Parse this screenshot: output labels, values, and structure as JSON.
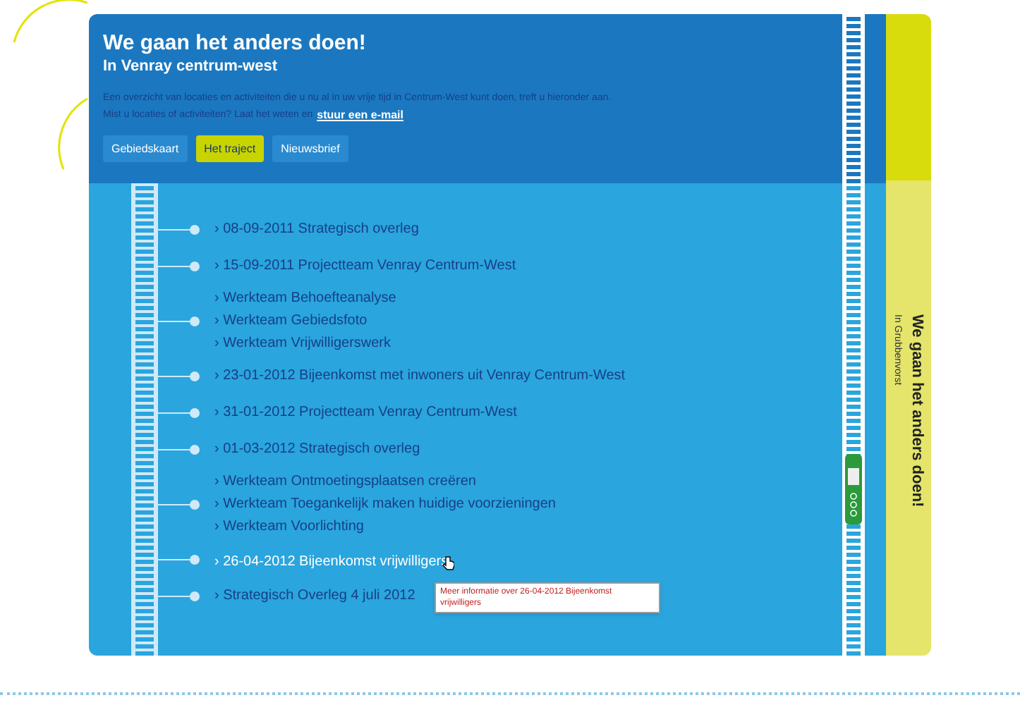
{
  "header": {
    "title": "We gaan het anders doen!",
    "subtitle": "In Venray centrum-west",
    "intro": [
      "Een overzicht van locaties en activiteiten die u nu al in uw vrije tijd in Centrum-West kunt doen, treft u hieronder aan.",
      "Mist u locaties of activiteiten? Laat het weten en"
    ],
    "link": "stuur een e-mail"
  },
  "tabs": [
    {
      "label": "Gebiedskaart",
      "selected": false
    },
    {
      "label": "Het traject",
      "selected": true
    },
    {
      "label": "Nieuwsbrief",
      "selected": false
    }
  ],
  "timeline": [
    {
      "entries": [
        {
          "text": "› 08-09-2011 Strategisch overleg",
          "hovered": false
        }
      ]
    },
    {
      "entries": [
        {
          "text": "› 15-09-2011 Projectteam Venray Centrum-West",
          "hovered": false
        }
      ]
    },
    {
      "entries": [
        {
          "text": "› Werkteam Behoefteanalyse",
          "hovered": false
        },
        {
          "text": "› Werkteam Gebiedsfoto",
          "hovered": false
        },
        {
          "text": "› Werkteam Vrijwilligerswerk",
          "hovered": false
        }
      ]
    },
    {
      "entries": [
        {
          "text": "› 23-01-2012 Bijeenkomst met inwoners uit Venray Centrum-West",
          "hovered": false
        }
      ]
    },
    {
      "entries": [
        {
          "text": "› 31-01-2012 Projectteam Venray Centrum-West",
          "hovered": false
        }
      ]
    },
    {
      "entries": [
        {
          "text": "› 01-03-2012 Strategisch overleg",
          "hovered": false
        }
      ]
    },
    {
      "entries": [
        {
          "text": "› Werkteam Ontmoetingsplaatsen creëren",
          "hovered": false
        },
        {
          "text": "› Werkteam Toegankelijk maken huidige voorzieningen",
          "hovered": false
        },
        {
          "text": "› Werkteam Voorlichting",
          "hovered": false
        }
      ]
    },
    {
      "entries": [
        {
          "text": "› 26-04-2012 Bijeenkomst vrijwilligers",
          "hovered": true
        }
      ]
    },
    {
      "entries": [
        {
          "text": "› Strategisch Overleg 4 juli 2012",
          "hovered": false
        }
      ]
    }
  ],
  "tooltip": "Meer informatie over 26-04-2012 Bijeenkomst vrijwilligers",
  "sidebar": {
    "title": "We gaan het anders doen!",
    "subtitle": "In Grubbenvorst"
  }
}
